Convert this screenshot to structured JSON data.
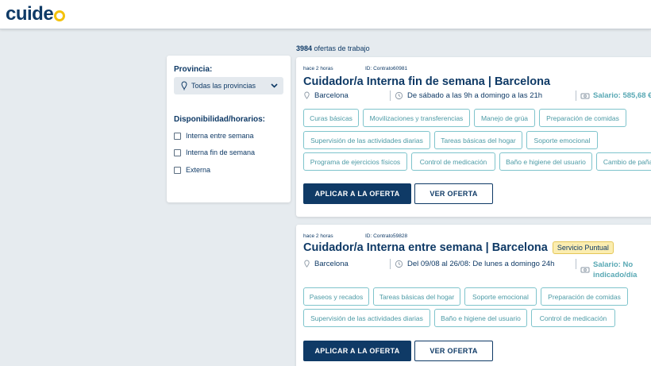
{
  "header": {
    "logo_text": "cuide"
  },
  "results": {
    "count": "3984",
    "suffix": " ofertas de trabajo"
  },
  "filters": {
    "province_label": "Provincia:",
    "province_value": "Todas las provincias",
    "availability_label": "Disponibilidad/horarios:",
    "options": [
      "Interna entre semana",
      "Interna fin de semana",
      "Externa"
    ]
  },
  "offers": [
    {
      "posted": "hace 2 horas",
      "id": "ID: Contrato60981",
      "title": "Cuidador/a Interna fin de semana | Barcelona",
      "badge": "",
      "location": "Barcelona",
      "schedule": "De sábado a las 9h a domingo a las 21h",
      "salary": "Salario: 585,68 €",
      "tags": [
        "Curas básicas",
        "Movilizaciones y transferencias",
        "Manejo de grúa",
        "Preparación de comidas",
        "Supervisión de las actividades diarias",
        "Tareas básicas del hogar",
        "Soporte emocional",
        "Programa de ejercicios físicos",
        "Control de medicación",
        "Baño e higiene del usuario",
        "Cambio de pañal"
      ],
      "apply_label": "APLICAR A LA OFERTA",
      "view_label": "VER OFERTA"
    },
    {
      "posted": "hace 2 horas",
      "id": "ID: Contrato59828",
      "title": "Cuidador/a Interna entre semana | Barcelona",
      "badge": "Servicio Puntual",
      "location": "Barcelona",
      "schedule": "Del 09/08 al 26/08: De lunes a domingo 24h",
      "salary": "Salario: No indicado/día",
      "tags": [
        "Paseos y recados",
        "Tareas básicas del hogar",
        "Soporte emocional",
        "Preparación de comidas",
        "Supervisión de las actividades diarias",
        "Baño e higiene del usuario",
        "Control de medicación"
      ],
      "apply_label": "APLICAR A LA OFERTA",
      "view_label": "VER OFERTA"
    }
  ],
  "colors": {
    "brand": "#0f3a66",
    "accent": "#f4c20d",
    "tag": "#4d9ba6",
    "badge": "#fbedb0"
  }
}
